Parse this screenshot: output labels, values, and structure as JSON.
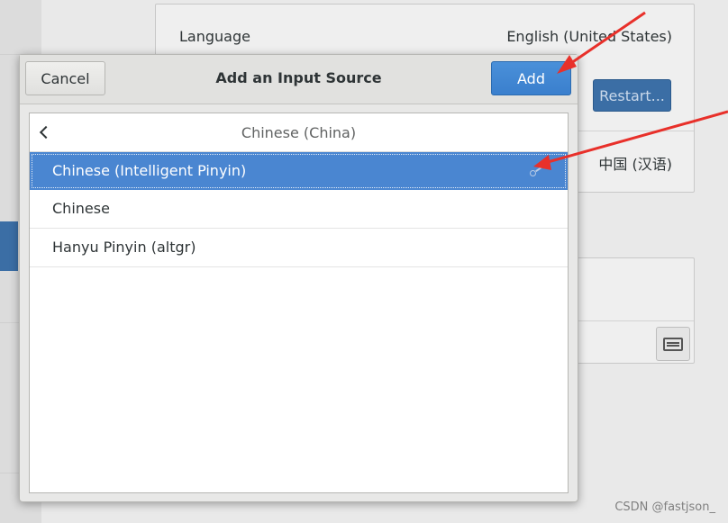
{
  "background": {
    "language_label": "Language",
    "language_value": "English (United States)",
    "restart_label": "Restart...",
    "formats_value": "中国 (汉语)",
    "keyboard_button_icon": "keyboard-icon"
  },
  "dialog": {
    "title": "Add an Input Source",
    "cancel_label": "Cancel",
    "add_label": "Add",
    "list_header": "Chinese (China)",
    "back_icon": "chevron-left-icon",
    "items": [
      {
        "label": "Chinese (Intelligent Pinyin)",
        "selected": true,
        "icon": "settings-icon"
      },
      {
        "label": "Chinese",
        "selected": false
      },
      {
        "label": "Hanyu Pinyin (altgr)",
        "selected": false
      }
    ]
  },
  "watermark": "CSDN @fastjson_",
  "colors": {
    "accent": "#4a86d1",
    "add_button": "#3a7fcd",
    "annotation_arrow": "#e8302a"
  }
}
